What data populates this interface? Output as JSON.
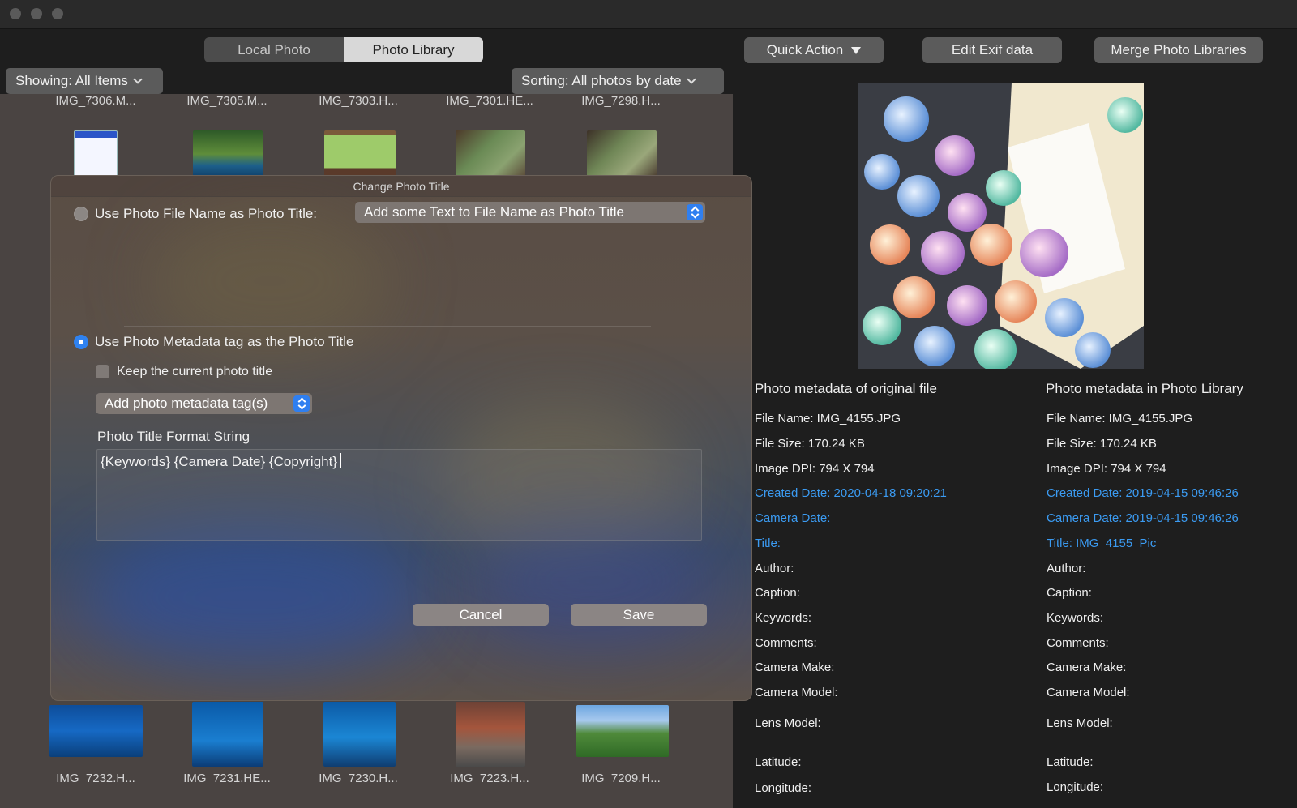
{
  "toolbar": {
    "tabs": [
      {
        "label": "Local Photo",
        "active": false
      },
      {
        "label": "Photo Library",
        "active": true
      }
    ],
    "quick_action": "Quick Action",
    "edit_exif": "Edit Exif data",
    "merge": "Merge Photo Libraries",
    "showing": "Showing: All Items",
    "sorting": "Sorting: All photos by date"
  },
  "grid": {
    "top_row": [
      "IMG_7306.M...",
      "IMG_7305.M...",
      "IMG_7303.H...",
      "IMG_7301.HE...",
      "IMG_7298.H..."
    ],
    "bottom_row": [
      "IMG_7232.H...",
      "IMG_7231.HE...",
      "IMG_7230.H...",
      "IMG_7223.H...",
      "IMG_7209.H..."
    ]
  },
  "metadata": {
    "original": {
      "heading": "Photo metadata of original file",
      "rows": [
        "File Name: IMG_4155.JPG",
        "File Size: 170.24 KB",
        "Image DPI: 794 X 794",
        "Created Date: 2020-04-18 09:20:21",
        "Camera Date:",
        "Title:",
        "Author:",
        "Caption:",
        "Keywords:",
        "Comments:",
        "Camera Make:",
        "Camera Model:",
        "Lens Model:",
        "Latitude:",
        "Longitude:"
      ]
    },
    "library": {
      "heading": "Photo metadata in Photo Library",
      "rows": [
        "File Name: IMG_4155.JPG",
        "File Size: 170.24 KB",
        "Image DPI: 794 X 794",
        "Created Date: 2019-04-15 09:46:26",
        "Camera Date: 2019-04-15 09:46:26",
        "Title: IMG_4155_Pic",
        "Author:",
        "Caption:",
        "Keywords:",
        "Comments:",
        "Camera Make:",
        "Camera Model:",
        "Lens Model:",
        "Latitude:",
        "Longitude:"
      ]
    },
    "highlight_color": "#3b9bf2"
  },
  "dialog": {
    "title": "Change Photo Title",
    "option_filename": "Use Photo File Name as Photo Title:",
    "filename_popup": "Add some Text to File Name as Photo Title",
    "option_metadata": "Use Photo Metadata tag as the Photo Title",
    "keep_current": "Keep the current photo title",
    "tag_popup": "Add photo metadata tag(s)",
    "format_label": "Photo Title Format String",
    "format_value": "{Keywords} {Camera Date} {Copyright}",
    "cancel": "Cancel",
    "save": "Save",
    "selected_option": "metadata"
  }
}
